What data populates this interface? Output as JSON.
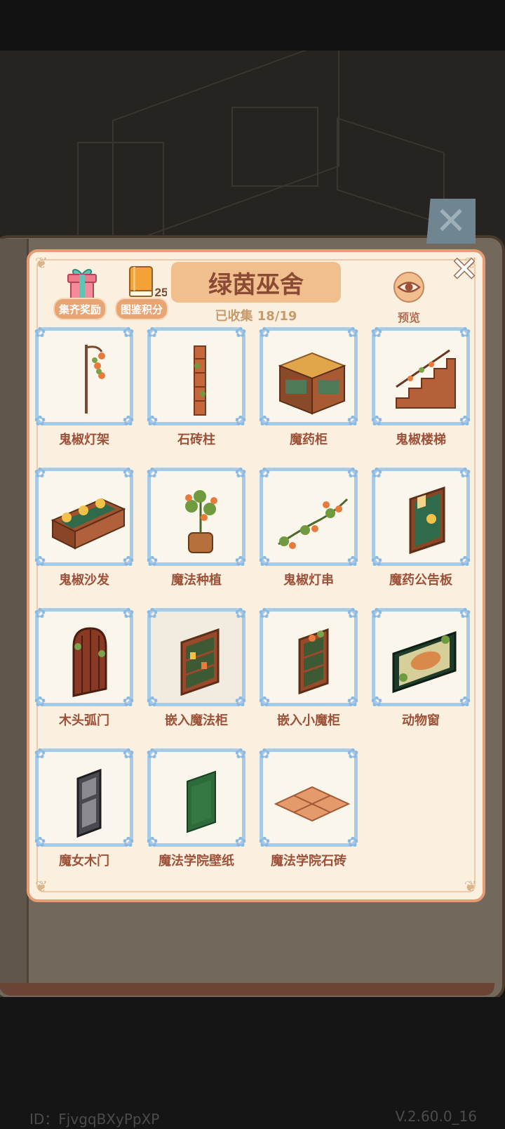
{
  "header": {
    "reward_label": "集齐奖励",
    "points_label": "图鉴积分",
    "points_value": "25",
    "title": "绿茵巫舍",
    "collected": "已收集 18/19",
    "preview_label": "预览"
  },
  "items": [
    {
      "name": "鬼椒灯架"
    },
    {
      "name": "石砖柱"
    },
    {
      "name": "魔药柜"
    },
    {
      "name": "鬼椒楼梯"
    },
    {
      "name": "鬼椒沙发"
    },
    {
      "name": "魔法种植"
    },
    {
      "name": "鬼椒灯串"
    },
    {
      "name": "魔药公告板"
    },
    {
      "name": "木头弧门"
    },
    {
      "name": "嵌入魔法柜"
    },
    {
      "name": "嵌入小魔柜"
    },
    {
      "name": "动物窗"
    },
    {
      "name": "魔女木门"
    },
    {
      "name": "魔法学院壁纸"
    },
    {
      "name": "魔法学院石砖"
    }
  ],
  "footer": {
    "id": "ID：FjvgqBXyPpXP",
    "version": "V.2.60.0_16"
  },
  "colors": {
    "panel_bg": "#fbf0e0",
    "panel_border": "#e69c73",
    "title_bg": "#f1be8e",
    "frame_border": "#a6cce9",
    "label_text": "#9c5138"
  }
}
